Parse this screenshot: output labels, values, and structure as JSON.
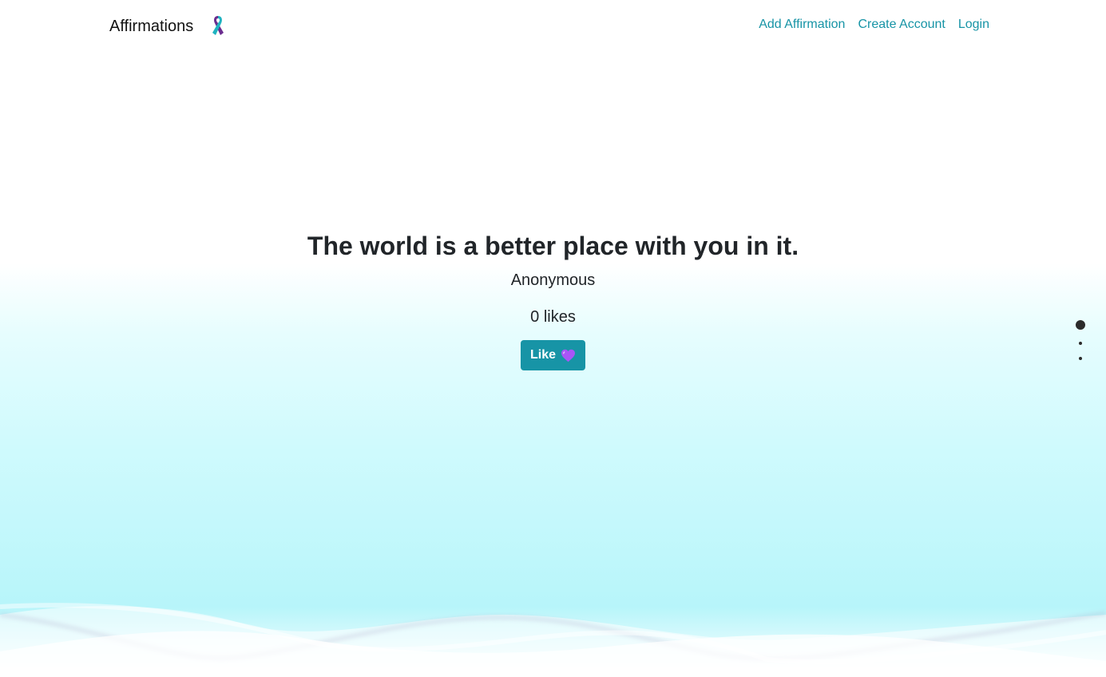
{
  "navbar": {
    "brand": "Affirmations",
    "brand_icon": "awareness-ribbon-icon",
    "links": [
      "Add Affirmation",
      "Create Account",
      "Login"
    ]
  },
  "affirmation": {
    "text": "The world is a better place with you in it.",
    "author": "Anonymous",
    "likes": "0 likes",
    "like_button": "Like",
    "like_icon": "purple-heart-icon"
  },
  "pagination": {
    "total": 3,
    "current": 1
  },
  "colors": {
    "accent": "#1794a6",
    "text": "#212529",
    "background_top": "#ffffff",
    "background_bottom": "#b7f5fa",
    "heart": "#a855f7"
  }
}
